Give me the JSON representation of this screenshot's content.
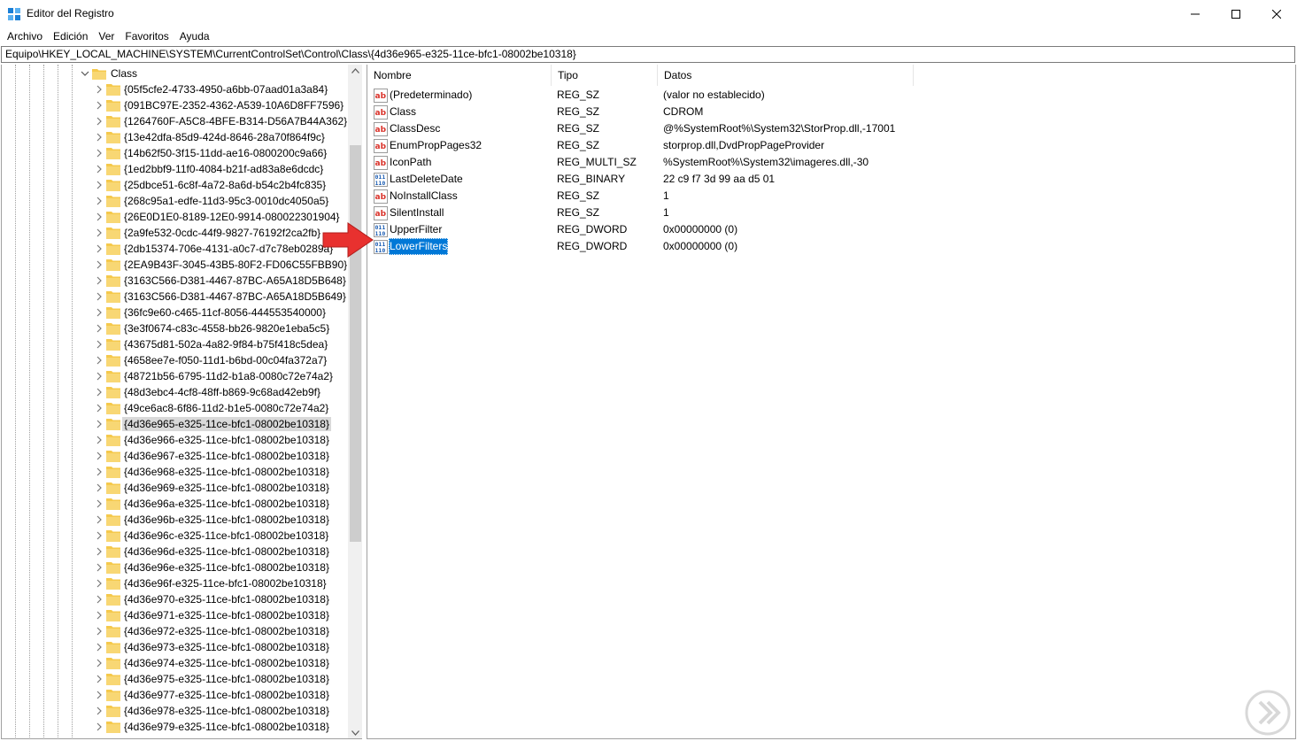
{
  "window": {
    "title": "Editor del Registro",
    "icon": "regedit-icon",
    "controls": [
      "minimize-icon",
      "maximize-icon",
      "close-icon"
    ]
  },
  "menu": [
    "Archivo",
    "Edición",
    "Ver",
    "Favoritos",
    "Ayuda"
  ],
  "address": "Equipo\\HKEY_LOCAL_MACHINE\\SYSTEM\\CurrentControlSet\\Control\\Class\\{4d36e965-e325-11ce-bfc1-08002be10318}",
  "tree": {
    "parent": "Class",
    "selected_index": 21,
    "items": [
      "{05f5cfe2-4733-4950-a6bb-07aad01a3a84}",
      "{091BC97E-2352-4362-A539-10A6D8FF7596}",
      "{1264760F-A5C8-4BFE-B314-D56A7B44A362}",
      "{13e42dfa-85d9-424d-8646-28a70f864f9c}",
      "{14b62f50-3f15-11dd-ae16-0800200c9a66}",
      "{1ed2bbf9-11f0-4084-b21f-ad83a8e6dcdc}",
      "{25dbce51-6c8f-4a72-8a6d-b54c2b4fc835}",
      "{268c95a1-edfe-11d3-95c3-0010dc4050a5}",
      "{26E0D1E0-8189-12E0-9914-080022301904}",
      "{2a9fe532-0cdc-44f9-9827-76192f2ca2fb}",
      "{2db15374-706e-4131-a0c7-d7c78eb0289a}",
      "{2EA9B43F-3045-43B5-80F2-FD06C55FBB90}",
      "{3163C566-D381-4467-87BC-A65A18D5B648}",
      "{3163C566-D381-4467-87BC-A65A18D5B649}",
      "{36fc9e60-c465-11cf-8056-444553540000}",
      "{3e3f0674-c83c-4558-bb26-9820e1eba5c5}",
      "{43675d81-502a-4a82-9f84-b75f418c5dea}",
      "{4658ee7e-f050-11d1-b6bd-00c04fa372a7}",
      "{48721b56-6795-11d2-b1a8-0080c72e74a2}",
      "{48d3ebc4-4cf8-48ff-b869-9c68ad42eb9f}",
      "{49ce6ac8-6f86-11d2-b1e5-0080c72e74a2}",
      "{4d36e965-e325-11ce-bfc1-08002be10318}",
      "{4d36e966-e325-11ce-bfc1-08002be10318}",
      "{4d36e967-e325-11ce-bfc1-08002be10318}",
      "{4d36e968-e325-11ce-bfc1-08002be10318}",
      "{4d36e969-e325-11ce-bfc1-08002be10318}",
      "{4d36e96a-e325-11ce-bfc1-08002be10318}",
      "{4d36e96b-e325-11ce-bfc1-08002be10318}",
      "{4d36e96c-e325-11ce-bfc1-08002be10318}",
      "{4d36e96d-e325-11ce-bfc1-08002be10318}",
      "{4d36e96e-e325-11ce-bfc1-08002be10318}",
      "{4d36e96f-e325-11ce-bfc1-08002be10318}",
      "{4d36e970-e325-11ce-bfc1-08002be10318}",
      "{4d36e971-e325-11ce-bfc1-08002be10318}",
      "{4d36e972-e325-11ce-bfc1-08002be10318}",
      "{4d36e973-e325-11ce-bfc1-08002be10318}",
      "{4d36e974-e325-11ce-bfc1-08002be10318}",
      "{4d36e975-e325-11ce-bfc1-08002be10318}",
      "{4d36e977-e325-11ce-bfc1-08002be10318}",
      "{4d36e978-e325-11ce-bfc1-08002be10318}",
      "{4d36e979-e325-11ce-bfc1-08002be10318}"
    ]
  },
  "list": {
    "columns": [
      "Nombre",
      "Tipo",
      "Datos"
    ],
    "selected_index": 9,
    "rows": [
      {
        "icon": "string-value-icon",
        "name": "(Predeterminado)",
        "type": "REG_SZ",
        "data": "(valor no establecido)"
      },
      {
        "icon": "string-value-icon",
        "name": "Class",
        "type": "REG_SZ",
        "data": "CDROM"
      },
      {
        "icon": "string-value-icon",
        "name": "ClassDesc",
        "type": "REG_SZ",
        "data": "@%SystemRoot%\\System32\\StorProp.dll,-17001"
      },
      {
        "icon": "string-value-icon",
        "name": "EnumPropPages32",
        "type": "REG_SZ",
        "data": "storprop.dll,DvdPropPageProvider"
      },
      {
        "icon": "string-value-icon",
        "name": "IconPath",
        "type": "REG_MULTI_SZ",
        "data": "%SystemRoot%\\System32\\imageres.dll,-30"
      },
      {
        "icon": "binary-value-icon",
        "name": "LastDeleteDate",
        "type": "REG_BINARY",
        "data": "22 c9 f7 3d 99 aa d5 01"
      },
      {
        "icon": "string-value-icon",
        "name": "NoInstallClass",
        "type": "REG_SZ",
        "data": "1"
      },
      {
        "icon": "string-value-icon",
        "name": "SilentInstall",
        "type": "REG_SZ",
        "data": "1"
      },
      {
        "icon": "binary-value-icon",
        "name": "UpperFilter",
        "type": "REG_DWORD",
        "data": "0x00000000 (0)"
      },
      {
        "icon": "binary-value-icon",
        "name": "LowerFilters",
        "type": "REG_DWORD",
        "data": "0x00000000 (0)"
      }
    ]
  },
  "annotation": {
    "icon": "red-arrow-icon",
    "color": "#e8312f"
  },
  "colors": {
    "selection": "#0078d7",
    "folder": "#f5c94c",
    "string_icon": "#d9322a",
    "binary_icon": "#1f5fb3"
  }
}
